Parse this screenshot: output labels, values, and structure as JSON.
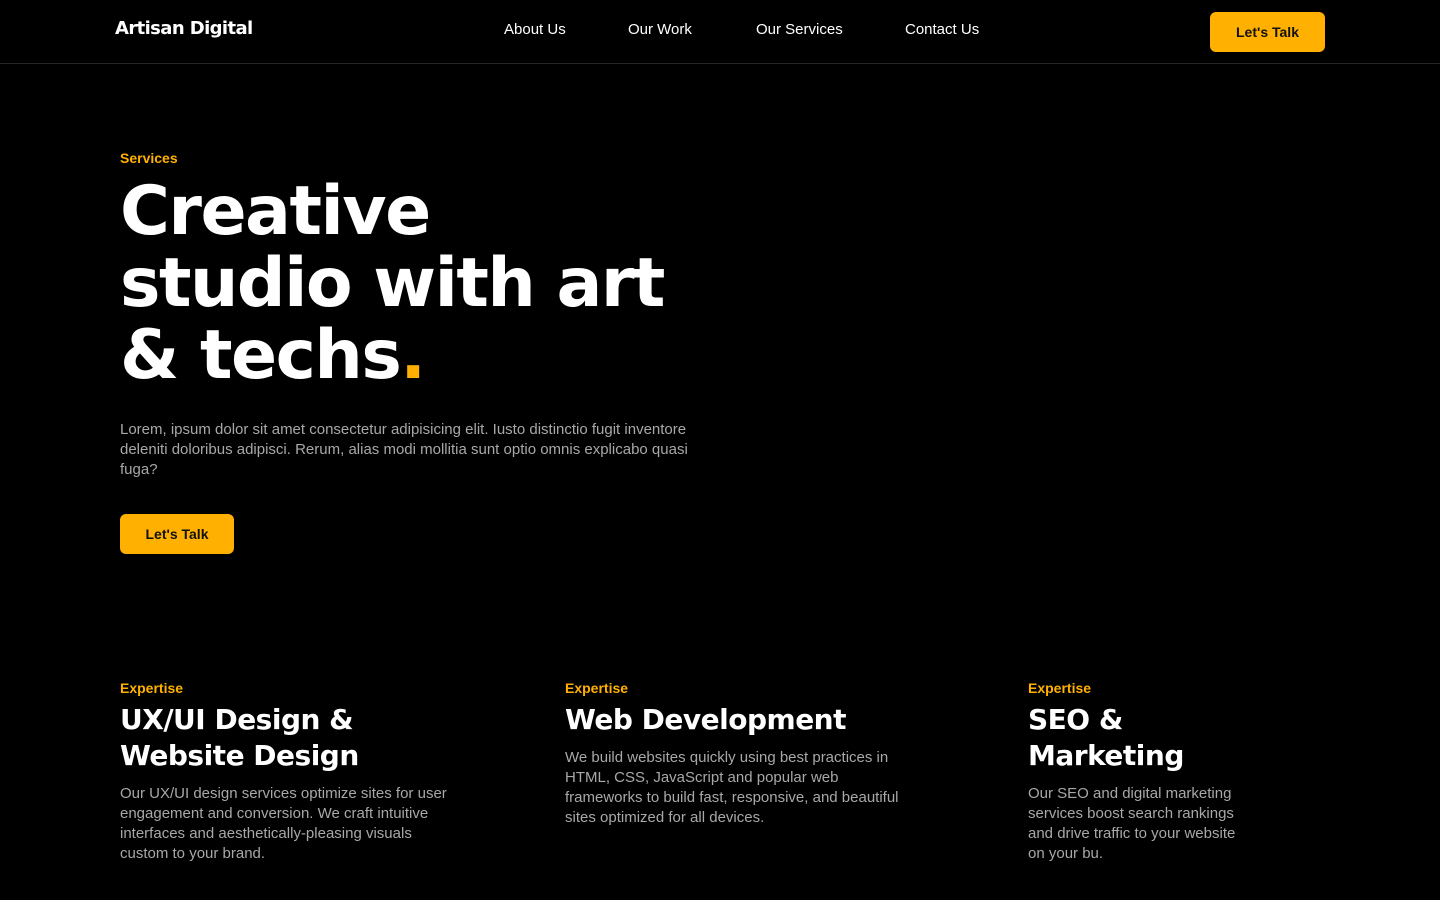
{
  "nav": {
    "brand": "Artisan Digital",
    "links": [
      "About Us",
      "Our Work",
      "Our Services",
      "Contact Us"
    ],
    "cta": "Let's Talk"
  },
  "hero": {
    "eyebrow": "Services",
    "title_line1": "Creative",
    "title_line2": "studio with art",
    "title_line3": "& techs",
    "title_dot": ".",
    "description": "Lorem, ipsum dolor sit amet consectetur adipisicing elit. Iusto distinctio fugit inventore deleniti doloribus adipisci. Rerum, alias modi mollitia sunt optio omnis explicabo quasi fuga?",
    "cta": "Let's Talk"
  },
  "services": [
    {
      "eyebrow": "Expertise",
      "title": "UX/UI Design & Website Design",
      "description": "Our UX/UI design services optimize sites for user engagement and conversion. We craft intuitive interfaces and aesthetically-pleasing visuals custom to your brand."
    },
    {
      "eyebrow": "Expertise",
      "title": "Web Development",
      "description": "We build websites quickly using best practices in HTML, CSS, JavaScript and popular web frameworks to build fast, responsive, and beautiful sites optimized for all devices."
    },
    {
      "eyebrow": "Expertise",
      "title": "SEO & Marketing",
      "description": "Our SEO and digital marketing services boost search rankings and drive traffic to your website on your bu."
    }
  ],
  "colors": {
    "background": "#000000",
    "accent": "#ffb000",
    "text": "#ffffff",
    "muted": "#a8a8a8"
  }
}
